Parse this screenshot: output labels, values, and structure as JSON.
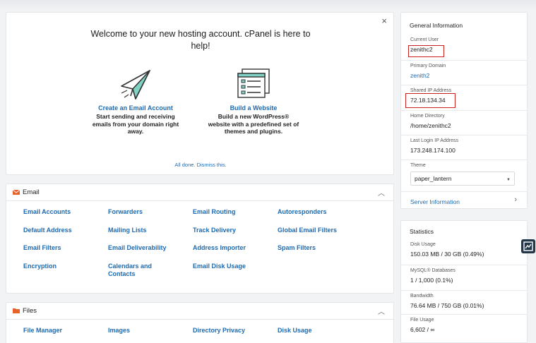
{
  "welcome": {
    "title": "Welcome to your new hosting account. cPanel is here to help!",
    "close": "×",
    "dismiss": "All done. Dismiss this.",
    "email_option": {
      "link": "Create an Email Account",
      "desc": "Start sending and receiving emails from your domain right away."
    },
    "website_option": {
      "link": "Build a Website",
      "desc": "Build a new WordPress® website with a predefined set of themes and plugins."
    }
  },
  "email_panel": {
    "title": "Email",
    "links": [
      "Email Accounts",
      "Forwarders",
      "Email Routing",
      "Autoresponders",
      "Default Address",
      "Mailing Lists",
      "Track Delivery",
      "Global Email Filters",
      "Email Filters",
      "Email Deliverability",
      "Address Importer",
      "Spam Filters",
      "Encryption",
      "Calendars and Contacts",
      "Email Disk Usage"
    ]
  },
  "files_panel": {
    "title": "Files",
    "links": [
      "File Manager",
      "Images",
      "Directory Privacy",
      "Disk Usage"
    ]
  },
  "general_info": {
    "title": "General Information",
    "current_user_label": "Current User",
    "current_user": "zenithc2",
    "primary_domain_label": "Primary Domain",
    "primary_domain": "zenith2",
    "shared_ip_label": "Shared IP Address",
    "shared_ip": "72.18.134.34",
    "home_dir_label": "Home Directory",
    "home_dir": "/home/zenithc2",
    "last_login_label": "Last Login IP Address",
    "last_login": "173.248.174.100",
    "theme_label": "Theme",
    "theme": "paper_lantern",
    "server_info": "Server Information"
  },
  "statistics": {
    "title": "Statistics",
    "disk_label": "Disk Usage",
    "disk": "150.03 MB / 30 GB  (0.49%)",
    "mysql_label": "MySQL® Databases",
    "mysql": "1 / 1,000  (0.1%)",
    "bandwidth_label": "Bandwidth",
    "bandwidth": "76.64 MB / 750 GB  (0.01%)",
    "file_label": "File Usage",
    "file": "6,602 / ∞"
  },
  "colors": {
    "link": "#1e6ab1",
    "highlight": "#cc1f1f",
    "icon_orange": "#e8622c"
  }
}
